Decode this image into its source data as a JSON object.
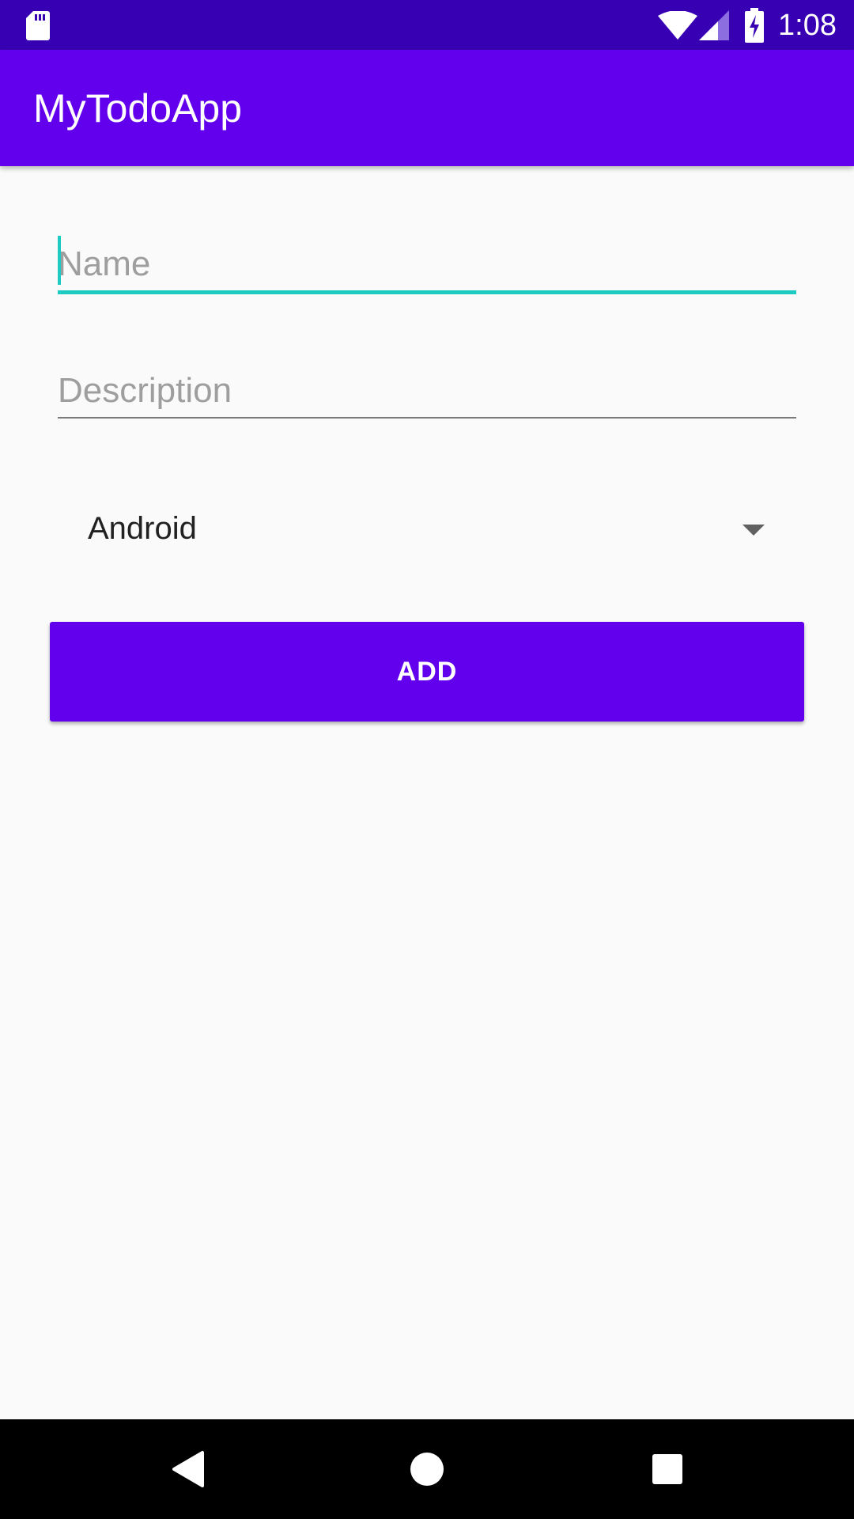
{
  "status_bar": {
    "time": "1:08",
    "icons": [
      "sd-card-icon",
      "wifi-icon",
      "cell-signal-icon",
      "battery-charging-icon"
    ]
  },
  "app_bar": {
    "title": "MyTodoApp"
  },
  "form": {
    "name_placeholder": "Name",
    "name_value": "",
    "description_placeholder": "Description",
    "description_value": "",
    "category_selected": "Android",
    "add_label": "ADD"
  },
  "nav_bar": {
    "icons": [
      "back-icon",
      "home-icon",
      "recents-icon"
    ]
  },
  "colors": {
    "status_bar": "#3700b3",
    "primary": "#6200ee",
    "accent": "#1ecbc3",
    "background": "#fafafa"
  }
}
